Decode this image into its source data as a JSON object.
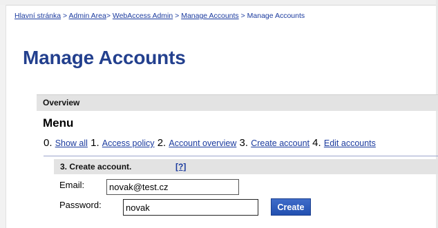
{
  "breadcrumb": {
    "items": [
      "Hlavní stránka",
      "Admin Area",
      "WebAccess Admin",
      "Manage Accounts"
    ],
    "separator": ">",
    "current": "Manage Accounts"
  },
  "page": {
    "title": "Manage Accounts"
  },
  "overview": {
    "label": "Overview"
  },
  "menu": {
    "title": "Menu",
    "items": [
      {
        "number": "0.",
        "label": "Show all"
      },
      {
        "number": "1.",
        "label": "Access policy"
      },
      {
        "number": "2.",
        "label": "Account overview"
      },
      {
        "number": "3.",
        "label": "Create account"
      },
      {
        "number": "4.",
        "label": "Edit accounts"
      }
    ]
  },
  "create_account": {
    "section_title": "3. Create account.",
    "help_label": "[?]",
    "email_label": "Email:",
    "email_value": "novak@test.cz",
    "password_label": "Password:",
    "password_value": "novak",
    "create_label": "Create"
  },
  "colors": {
    "link": "#1a3a9e",
    "title": "#23408e",
    "bar_background": "#e3e3e3",
    "button": "#2f5dbf"
  }
}
